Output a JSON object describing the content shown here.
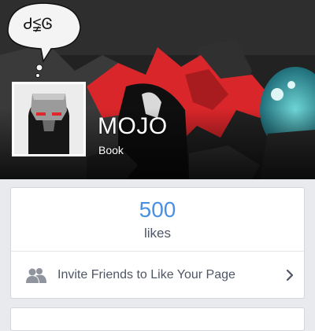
{
  "cover": {
    "speech_bubble_text": "Ꮷ≨Ꮆ"
  },
  "page": {
    "name": "MOJO",
    "category": "Book"
  },
  "stats": {
    "likes_count": "500",
    "likes_label": "likes"
  },
  "invite": {
    "label": "Invite Friends to Like Your Page",
    "icon": "friends-icon"
  },
  "colors": {
    "accent": "#4a90e2",
    "text_muted": "#4e5665",
    "background": "#e9eaed",
    "cover_red": "#d9262a",
    "cover_cyan": "#3aa7b3"
  }
}
